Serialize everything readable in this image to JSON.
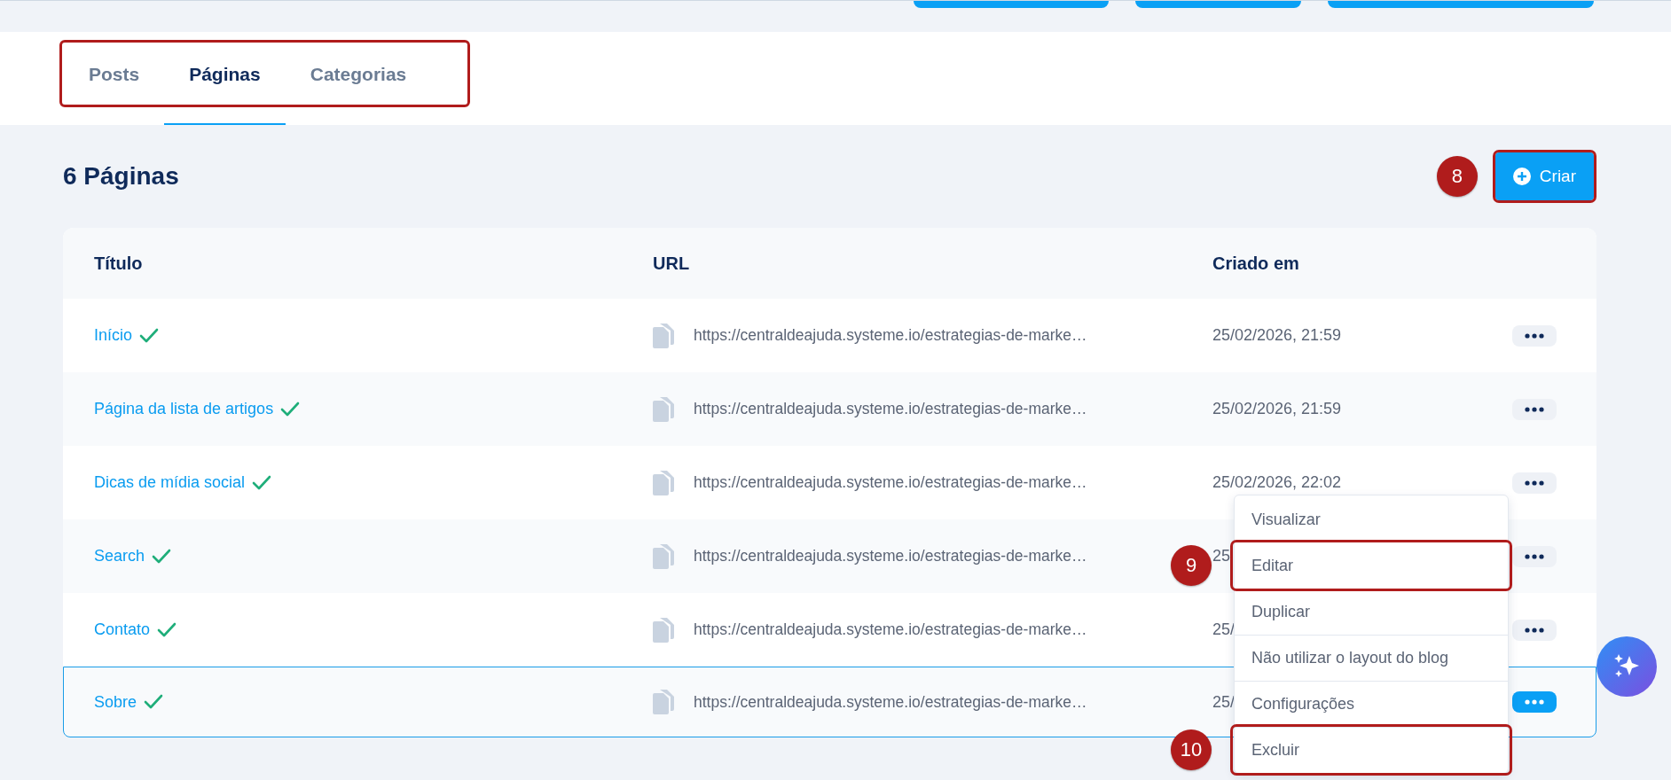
{
  "tabs": [
    {
      "label": "Posts",
      "selected": false
    },
    {
      "label": "Páginas",
      "selected": true
    },
    {
      "label": "Categorias",
      "selected": false
    }
  ],
  "tabs_highlighted": true,
  "heading": "6 Páginas",
  "create_button": {
    "label": "Criar",
    "highlighted": true,
    "marker": "8"
  },
  "table": {
    "columns": [
      "Título",
      "URL",
      "Criado em"
    ],
    "rows": [
      {
        "title": "Início",
        "published": true,
        "url": "https://centraldeajuda.systeme.io/estrategias-de-marke…",
        "created": "25/02/2026, 21:59",
        "selected": false
      },
      {
        "title": "Página da lista de artigos",
        "published": true,
        "url": "https://centraldeajuda.systeme.io/estrategias-de-marke…",
        "created": "25/02/2026, 21:59",
        "selected": false
      },
      {
        "title": "Dicas de mídia social",
        "published": true,
        "url": "https://centraldeajuda.systeme.io/estrategias-de-marke…",
        "created": "25/02/2026, 22:02",
        "selected": false
      },
      {
        "title": "Search",
        "published": true,
        "url": "https://centraldeajuda.systeme.io/estrategias-de-marke…",
        "created": "25",
        "selected": false
      },
      {
        "title": "Contato",
        "published": true,
        "url": "https://centraldeajuda.systeme.io/estrategias-de-marke…",
        "created": "25/",
        "selected": false
      },
      {
        "title": "Sobre",
        "published": true,
        "url": "https://centraldeajuda.systeme.io/estrategias-de-marke…",
        "created": "25/",
        "selected": true
      }
    ]
  },
  "row_menu": {
    "items": [
      {
        "label": "Visualizar",
        "separated": false,
        "highlighted": false
      },
      {
        "label": "Editar",
        "separated": false,
        "highlighted": true,
        "marker": "9"
      },
      {
        "label": "Duplicar",
        "separated": false,
        "highlighted": false
      },
      {
        "label": "Não utilizar o layout do blog",
        "separated": true,
        "highlighted": false
      },
      {
        "label": "Configurações",
        "separated": true,
        "highlighted": false
      },
      {
        "label": "Excluir",
        "separated": true,
        "highlighted": true,
        "marker": "10"
      }
    ]
  }
}
